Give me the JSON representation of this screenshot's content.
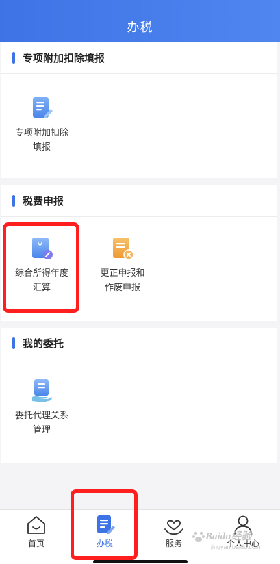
{
  "header": {
    "title": "办税"
  },
  "sections": [
    {
      "title": "专项附加扣除填报",
      "items": [
        {
          "label_line1": "专项附加扣除",
          "label_line2": "填报",
          "icon": "document-edit-icon"
        }
      ]
    },
    {
      "title": "税费申报",
      "items": [
        {
          "label_line1": "综合所得年度",
          "label_line2": "汇算",
          "icon": "yuan-document-icon"
        },
        {
          "label_line1": "更正申报和",
          "label_line2": "作废申报",
          "icon": "cancel-document-icon"
        }
      ]
    },
    {
      "title": "我的委托",
      "items": [
        {
          "label_line1": "委托代理关系",
          "label_line2": "管理",
          "icon": "hand-document-icon"
        }
      ]
    }
  ],
  "tabbar": {
    "tabs": [
      {
        "label": "首页",
        "icon": "home-icon",
        "active": false
      },
      {
        "label": "办税",
        "icon": "tax-document-icon",
        "active": true
      },
      {
        "label": "服务",
        "icon": "heart-hand-icon",
        "active": false
      },
      {
        "label": "个人中心",
        "icon": "person-icon",
        "active": false
      }
    ]
  },
  "watermark": {
    "text": "Baidu经验",
    "url": "jingyan.baidu.com"
  },
  "colors": {
    "accent": "#3e73e6",
    "highlight": "#ff1f1f",
    "orange": "#f0a23c"
  }
}
